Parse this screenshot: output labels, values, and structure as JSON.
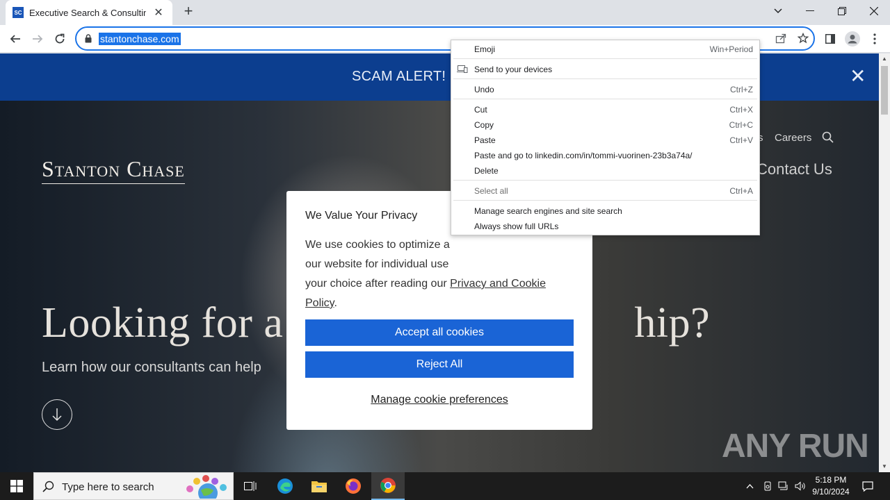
{
  "browser": {
    "tab_favicon": "SC",
    "tab_title": "Executive Search & Consulting F",
    "url": "stantonchase.com"
  },
  "page": {
    "alert_text": "SCAM ALERT! F",
    "logo": "Stanton Chase",
    "nav_partial": "s",
    "nav_careers": "Careers",
    "contact_link": "Contact Us",
    "hero_title_left": "Looking for a",
    "hero_title_right": "hip?",
    "hero_sub": "Learn how our consultants can help",
    "watermark": "ANY RUN"
  },
  "cookie_modal": {
    "title": "We Value Your Privacy",
    "body_line1": "We use cookies to optimize a",
    "body_line2": "our website for individual use",
    "body_line3": "your choice after reading our",
    "body_link": "Privacy and Cookie Policy",
    "body_end": ".",
    "accept_label": "Accept all cookies",
    "reject_label": "Reject All",
    "manage_label": "Manage cookie preferences"
  },
  "context_menu": {
    "items": [
      {
        "label": "Emoji",
        "shortcut": "Win+Period"
      },
      {
        "label": "Send to your devices",
        "shortcut": ""
      },
      {
        "label": "Undo",
        "shortcut": "Ctrl+Z"
      },
      {
        "label": "Cut",
        "shortcut": "Ctrl+X"
      },
      {
        "label": "Copy",
        "shortcut": "Ctrl+C"
      },
      {
        "label": "Paste",
        "shortcut": "Ctrl+V"
      },
      {
        "label": "Paste and go to linkedin.com/in/tommi-vuorinen-23b3a74a/",
        "shortcut": ""
      },
      {
        "label": "Delete",
        "shortcut": ""
      },
      {
        "label": "Select all",
        "shortcut": "Ctrl+A"
      },
      {
        "label": "Manage search engines and site search",
        "shortcut": ""
      },
      {
        "label": "Always show full URLs",
        "shortcut": ""
      }
    ]
  },
  "taskbar": {
    "search_placeholder": "Type here to search",
    "time": "5:18 PM",
    "date": "9/10/2024"
  },
  "colors": {
    "alert_bar": "#0c3e8f",
    "accent_blue": "#1a64d6",
    "omnibox_focus": "#1a73e8"
  }
}
